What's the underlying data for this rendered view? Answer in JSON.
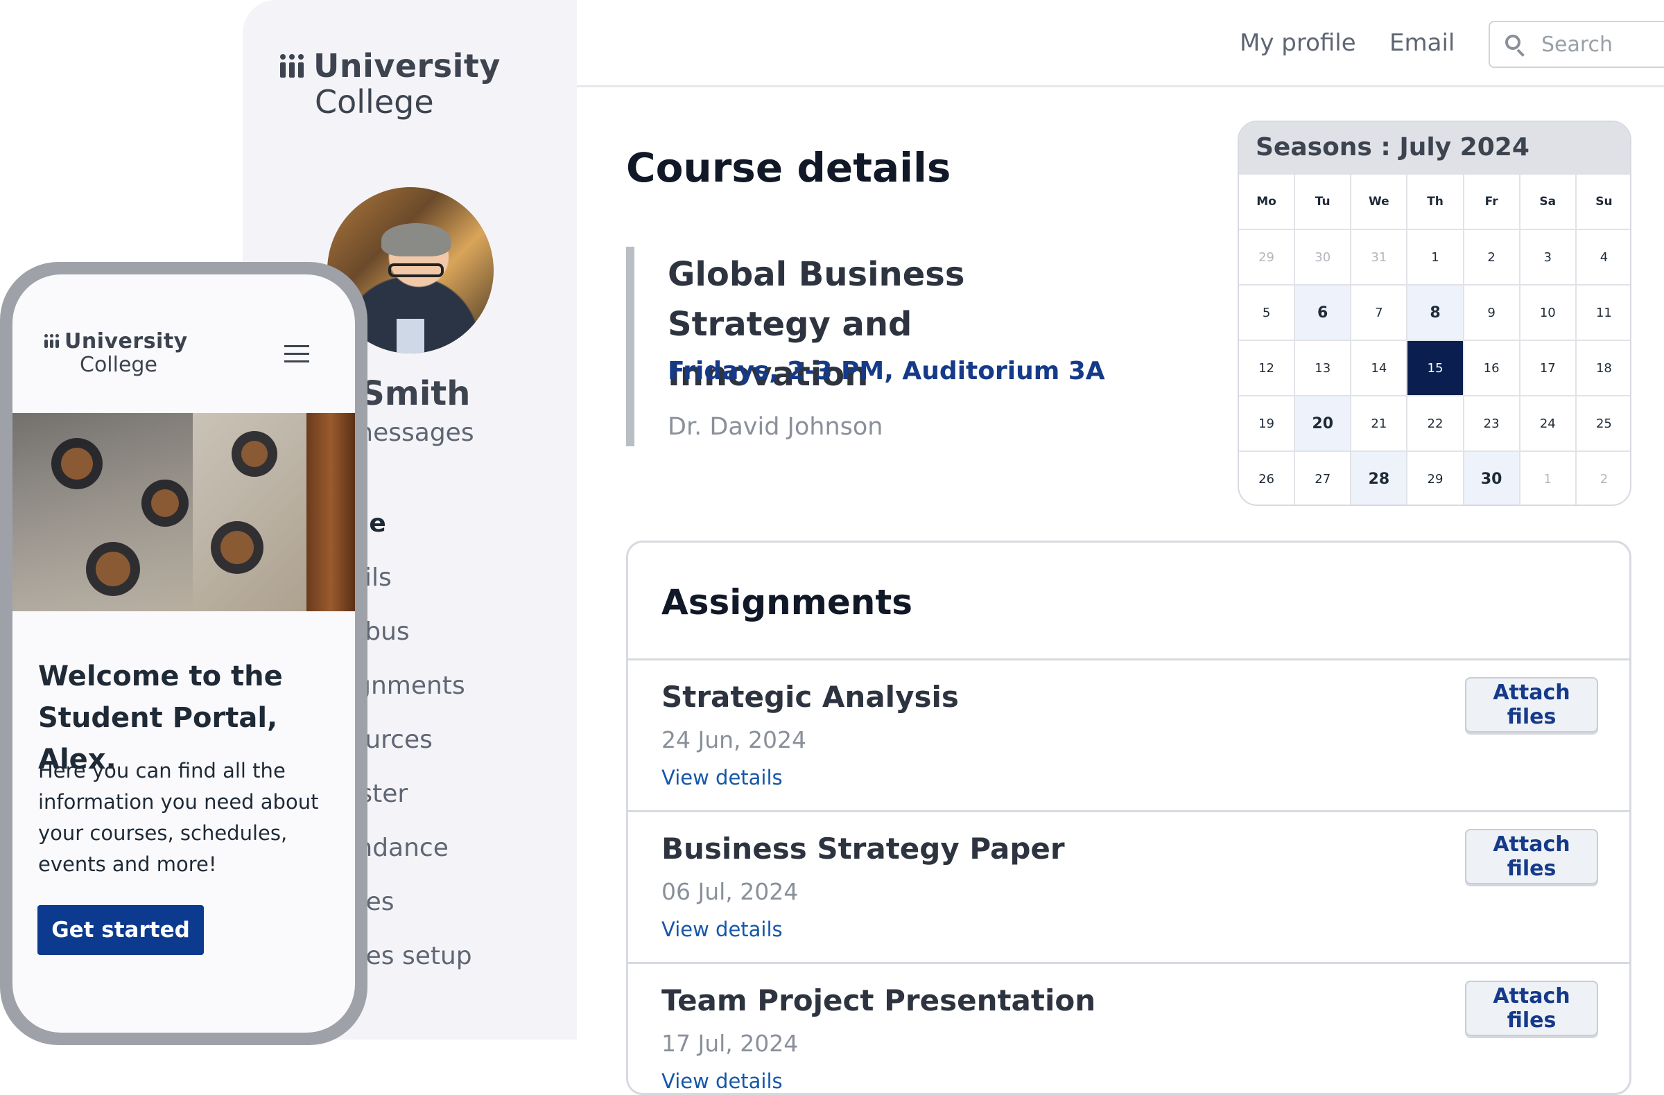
{
  "brand": {
    "line1": "University",
    "line2": "College"
  },
  "sidebar": {
    "profile_name": "ex Smith",
    "profile_sub": "ew messages",
    "nav": [
      {
        "label": "Home",
        "active": true
      },
      {
        "label": "Details"
      },
      {
        "label": "Syllabus"
      },
      {
        "label": "Assignments"
      },
      {
        "label": "Resources"
      },
      {
        "label": "Register"
      },
      {
        "label": "Attendance"
      },
      {
        "label": "Grades"
      },
      {
        "label": "Grades setup"
      }
    ]
  },
  "header": {
    "links": [
      "My profile",
      "Email"
    ],
    "search": {
      "placeholder": "Search",
      "icon": "search-icon"
    }
  },
  "course": {
    "page_title": "Course details",
    "title": "Global Business Strategy and Innovation",
    "schedule": "Fridays, 2-3 PM, Auditorium 3A",
    "teacher": "Dr. David Johnson"
  },
  "calendar": {
    "title": "Seasons : July 2024",
    "weekdays": [
      "Mo",
      "Tu",
      "We",
      "Th",
      "Fr",
      "Sa",
      "Su"
    ],
    "days": [
      [
        "29",
        "30",
        "31",
        "1",
        "2",
        "3",
        "4"
      ],
      [
        "5",
        "6",
        "7",
        "8",
        "9",
        "10",
        "11"
      ],
      [
        "12",
        "13",
        "14",
        "15",
        "16",
        "17",
        "18"
      ],
      [
        "19",
        "20",
        "21",
        "22",
        "23",
        "24",
        "25"
      ],
      [
        "26",
        "27",
        "28",
        "29",
        "30",
        "1",
        "2"
      ]
    ],
    "muted_days": [
      "29",
      "30",
      "31"
    ],
    "muted_trailing": [
      "1",
      "2"
    ],
    "highlighted_days": [
      "6",
      "8",
      "20",
      "28",
      "30"
    ],
    "selected_day": "15",
    "colors": {
      "selected": "#0a1f4f",
      "highlight": "#eef2fb"
    }
  },
  "assignments": {
    "title": "Assignments",
    "items": [
      {
        "name": "Strategic Analysis",
        "date": "24 Jun, 2024",
        "link": "View details",
        "button": "Attach files"
      },
      {
        "name": "Business Strategy Paper",
        "date": "06 Jul, 2024",
        "link": "View details",
        "button": "Attach files"
      },
      {
        "name": "Team Project Presentation",
        "date": "17 Jul, 2024",
        "link": "View details",
        "button": "Attach files"
      }
    ]
  },
  "mobile": {
    "welcome": "Welcome to the Student Portal, Alex.",
    "intro": "Here you can find all the information you need about your courses, schedules, events and more!",
    "cta": "Get started"
  },
  "colors": {
    "brand_blue": "#0b3a8e",
    "link_blue": "#1557a8",
    "sidebar_bg": "#f4f4f8"
  }
}
